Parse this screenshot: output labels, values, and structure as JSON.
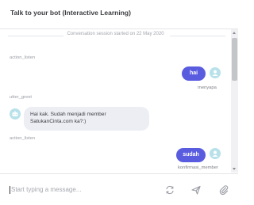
{
  "header": {
    "title": "Talk to your bot (Interactive Learning)"
  },
  "session": {
    "text": "Conversation session started on 22 May 2020"
  },
  "messages": [
    {
      "type": "action",
      "label": "action_listen"
    },
    {
      "type": "user",
      "text": "hai",
      "intent": "menyapa"
    },
    {
      "type": "action",
      "label": "utter_greet"
    },
    {
      "type": "bot",
      "line1": "Hai kak. Sudah menjadi member",
      "line2": "SatukanCinta.com ka?:)"
    },
    {
      "type": "action",
      "label": "action_listen"
    },
    {
      "type": "user",
      "text": "sudah",
      "intent": "konfirmasi_member"
    }
  ],
  "input": {
    "placeholder": "Start typing a message..."
  },
  "icons": {
    "restart": "restart-icon",
    "send": "send-icon",
    "attach": "paperclip-icon"
  },
  "colors": {
    "user_bubble": "#5a5ce0",
    "bot_bubble": "#eceef4",
    "avatar": "#b8e1ea"
  }
}
